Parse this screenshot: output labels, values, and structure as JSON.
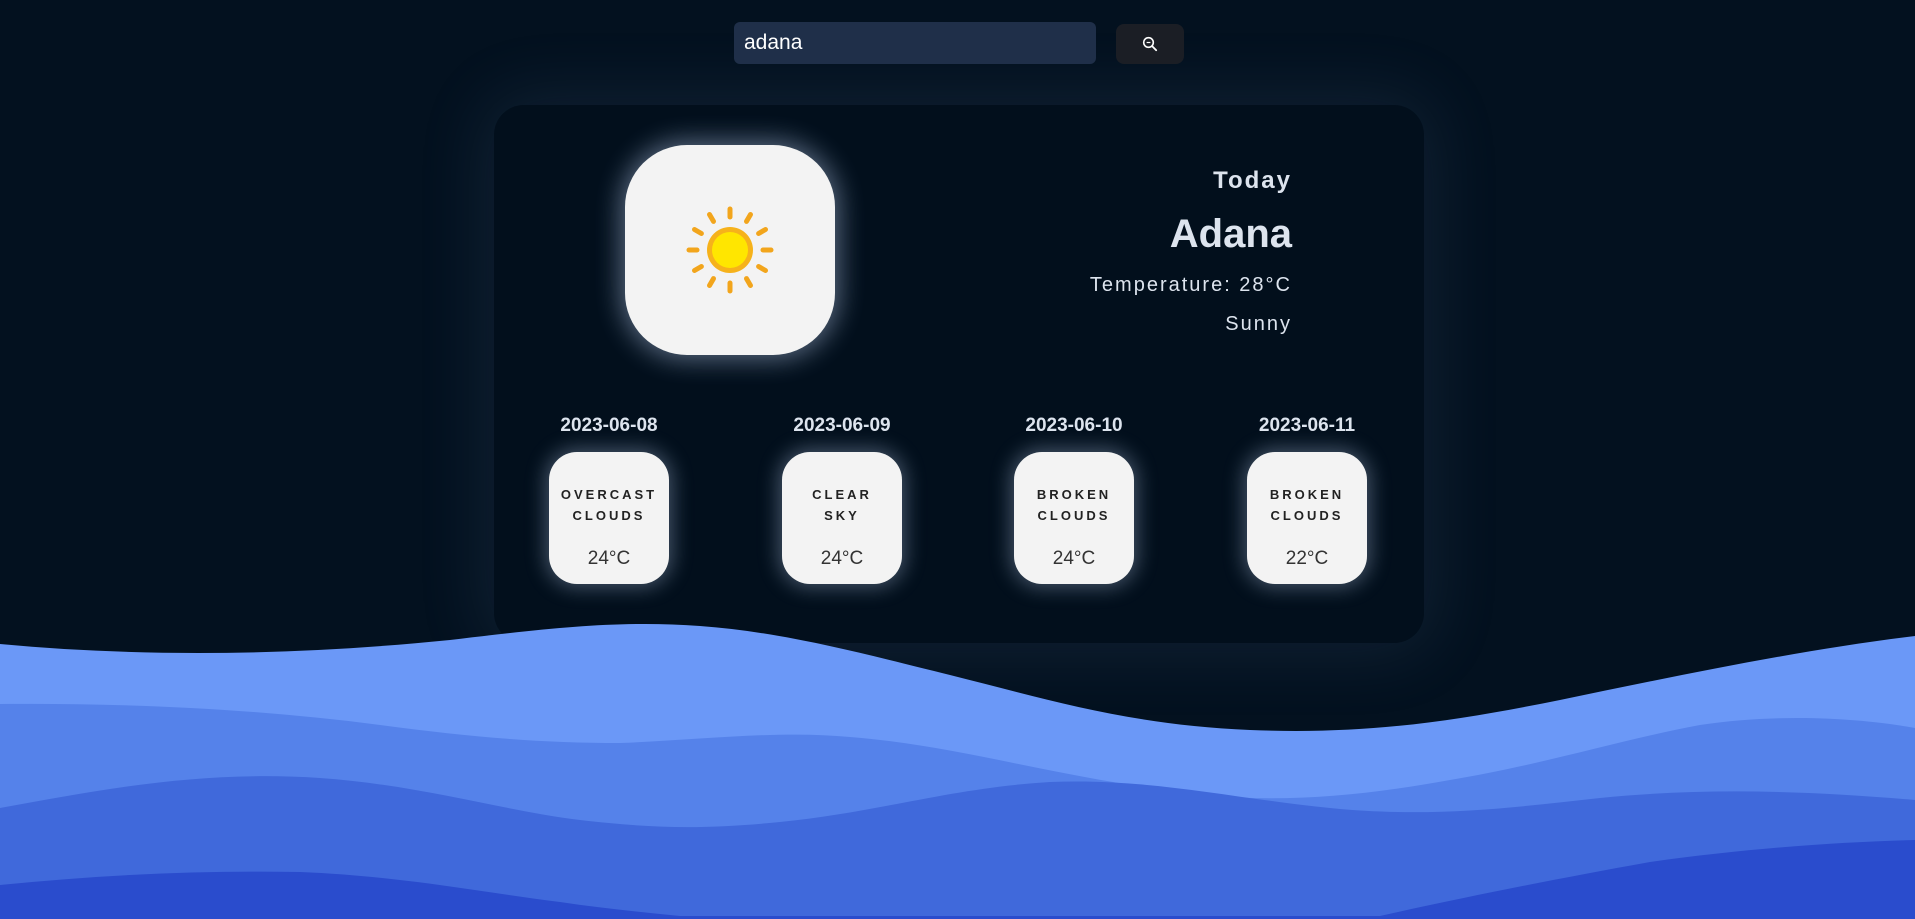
{
  "search": {
    "value": "adana",
    "placeholder": ""
  },
  "icons": {
    "search_button": "search-icon",
    "today_weather": "sun-icon"
  },
  "colors": {
    "background": "#03111f",
    "card": "#020f1c",
    "wave_light": "#6b98f7",
    "wave_dark": "#2a4ccd",
    "tile": "#f3f3f3"
  },
  "today": {
    "label": "Today",
    "city": "Adana",
    "temperature": "Temperature: 28°C",
    "description": "Sunny"
  },
  "forecast": [
    {
      "date": "2023-06-08",
      "line1": "OVERCAST",
      "line2": "CLOUDS",
      "temp": "24°C"
    },
    {
      "date": "2023-06-09",
      "line1": "CLEAR",
      "line2": "SKY",
      "temp": "24°C"
    },
    {
      "date": "2023-06-10",
      "line1": "BROKEN",
      "line2": "CLOUDS",
      "temp": "24°C"
    },
    {
      "date": "2023-06-11",
      "line1": "BROKEN",
      "line2": "CLOUDS",
      "temp": "22°C"
    }
  ]
}
